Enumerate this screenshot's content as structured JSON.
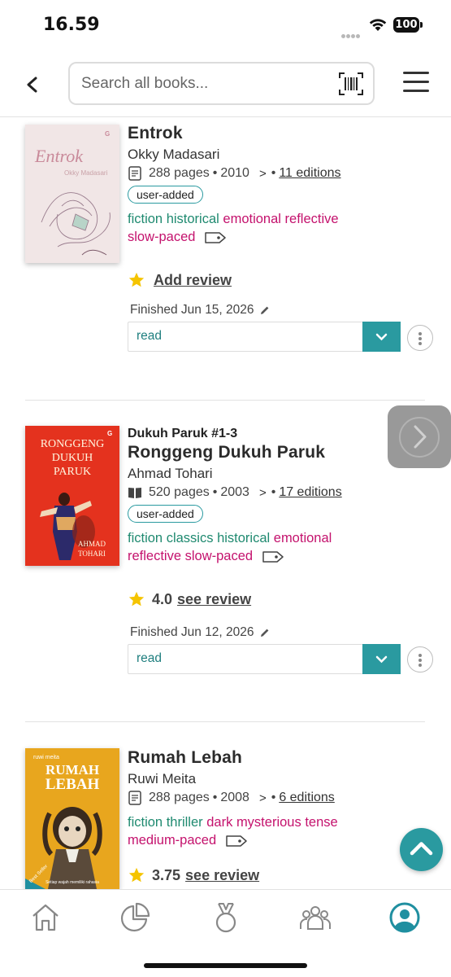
{
  "status_bar": {
    "time": "16.59",
    "battery": "100"
  },
  "header": {
    "search_placeholder": "Search all books..."
  },
  "books": [
    {
      "title": "Entrok",
      "author": "Okky Madasari",
      "pages": "288 pages",
      "year": "2010",
      "editions": "11 editions",
      "badge": "user-added",
      "genre_tags": [
        "fiction",
        "historical"
      ],
      "mood_tags": [
        "emotional",
        "reflective"
      ],
      "pace_tag": "slow-paced",
      "review_label": "Add review",
      "finished": "Finished Jun 15, 2026",
      "status": "read",
      "cover": {
        "title": "Entrok",
        "author": "Okky Madasari",
        "publisher": "G"
      }
    },
    {
      "series": "Dukuh Paruk #1-3",
      "title": "Ronggeng Dukuh Paruk",
      "author": "Ahmad Tohari",
      "pages": "520 pages",
      "year": "2003",
      "editions": "17 editions",
      "badge": "user-added",
      "genre_tags": [
        "fiction",
        "classics",
        "historical"
      ],
      "mood_tags": [
        "emotional",
        "reflective"
      ],
      "pace_tag": "slow-paced",
      "rating": "4.0",
      "review_label": "see review",
      "finished": "Finished Jun 12, 2026",
      "status": "read",
      "cover": {
        "line1": "RONGGENG",
        "line2": "DUKUH",
        "line3": "PARUK",
        "author1": "AHMAD",
        "author2": "TOHARI",
        "publisher": "G"
      }
    },
    {
      "title": "Rumah Lebah",
      "author": "Ruwi Meita",
      "pages": "288 pages",
      "year": "2008",
      "editions": "6 editions",
      "genre_tags": [
        "fiction",
        "thriller"
      ],
      "mood_tags": [
        "dark",
        "mysterious",
        "tense"
      ],
      "pace_tag": "medium-paced",
      "rating": "3.75",
      "review_label": "see review",
      "cover": {
        "author": "ruwi meita",
        "line1": "RUMAH",
        "line2": "LEBAH",
        "tagline": "Setiap wajah memiliki rahasia",
        "ribbon": "Best Seller"
      }
    }
  ],
  "colors": {
    "teal": "#2a9aa0",
    "genre": "#1f8a70",
    "mood": "#c4126d",
    "star": "#f5c400"
  },
  "icons": {
    "nav": [
      "home-icon",
      "stats-pie-icon",
      "challenges-medal-icon",
      "community-icon",
      "profile-icon"
    ]
  },
  "bottom_nav": {
    "active": "profile"
  }
}
